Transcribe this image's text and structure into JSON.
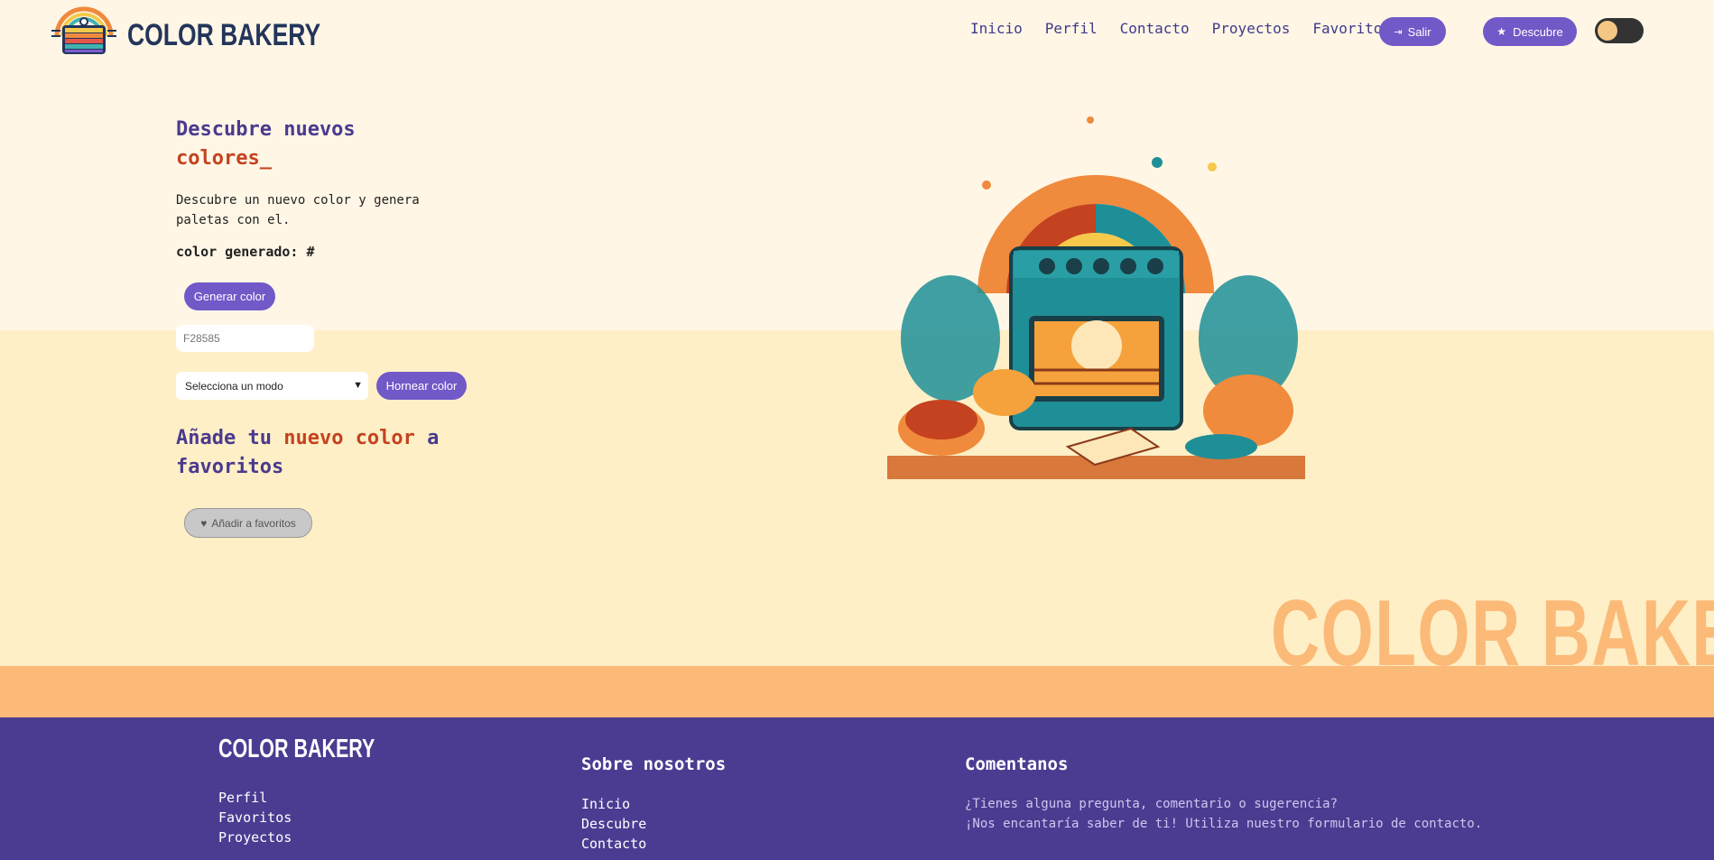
{
  "brand": {
    "name": "COLOR BAKERY"
  },
  "nav": {
    "links": [
      "Inicio",
      "Perfil",
      "Contacto",
      "Proyectos",
      "Favoritos"
    ],
    "salir": "Salir",
    "descubre": "Descubre"
  },
  "hero": {
    "title_part1": "Descubre nuevos",
    "title_part2": "colores_",
    "description": "Descubre un nuevo color y genera paletas con el.",
    "generated_label": "color generado: #",
    "generate_button": "Generar color",
    "color_input_placeholder": "F28585",
    "mode_select": "Selecciona un modo",
    "bake_button": "Hornear color"
  },
  "favorites": {
    "title_part1": "Añade tu",
    "title_part2": "nuevo color",
    "title_part3": "a favoritos",
    "button": "Añadir a favoritos"
  },
  "footer": {
    "brand": "COLOR BAKERY",
    "col1_links": [
      "Perfil",
      "Favoritos",
      "Proyectos"
    ],
    "about_title": "Sobre nosotros",
    "about_links": [
      "Inicio",
      "Descubre",
      "Contacto"
    ],
    "comment_title": "Comentanos",
    "comment_line1": "¿Tienes alguna pregunta, comentario o sugerencia?",
    "comment_line2": "¡Nos encantaría saber de ti! Utiliza nuestro formulario de contacto."
  },
  "colors": {
    "accent": "#7159c8",
    "title": "#4a3a8e",
    "highlight": "#c4421f",
    "footer": "#4b3c91",
    "band": "#fbba78"
  }
}
